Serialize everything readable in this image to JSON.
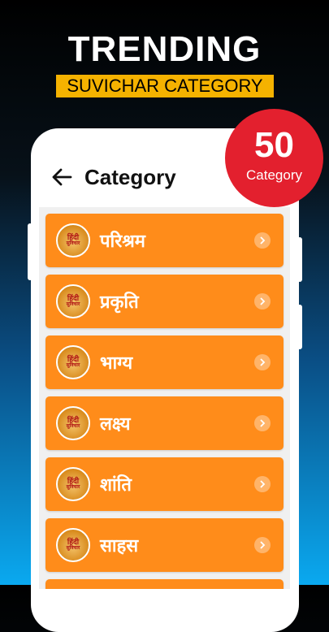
{
  "promo": {
    "headline": "TRENDING",
    "subheadline": "SUVICHAR CATEGORY"
  },
  "badge": {
    "count": "50",
    "label": "Category"
  },
  "header": {
    "title": "Category",
    "back_icon": "arrow-left-icon"
  },
  "logo": {
    "line1": "हिंदी",
    "line2": "सुविचार"
  },
  "categories": [
    {
      "label": "परिश्रम"
    },
    {
      "label": "प्रकृति"
    },
    {
      "label": "भाग्य"
    },
    {
      "label": "लक्ष्य"
    },
    {
      "label": "शांति"
    },
    {
      "label": "साहस"
    }
  ],
  "colors": {
    "item_bg": "#ff8c1a",
    "badge_bg": "#e3202e",
    "banner_bg": "#f5b200"
  }
}
